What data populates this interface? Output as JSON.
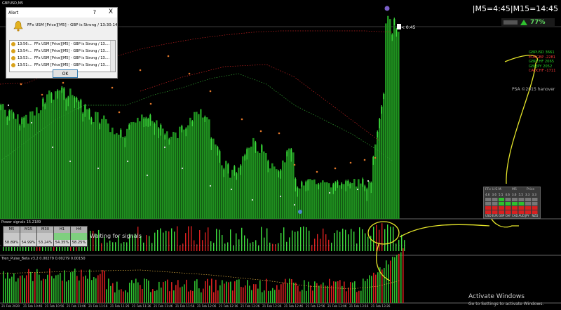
{
  "window": {
    "symbol_label": "GBPUSD,M5",
    "bid_label": "< 0:45"
  },
  "timer": {
    "text": "|M5=4:45|M15=14:45"
  },
  "percent": {
    "value": "77%"
  },
  "alert": {
    "title": "Alert",
    "help": "?",
    "close": "X",
    "message": "FFx USM [Price][M5] - GBP is Strong / 13:30:14",
    "rows": [
      {
        "time": "13:56:...",
        "text": "FFx USM [Price][M5] - GBP is Strong / 13...."
      },
      {
        "time": "13:54:...",
        "text": "FFx USM [Price][M5] - GBP is Strong / 13...."
      },
      {
        "time": "13:53:...",
        "text": "FFx USM [Price][M5] - GBP is Strong / 13...."
      },
      {
        "time": "13:51:...",
        "text": "FFx USM [Price][M5] - GBP is Strong / 13...."
      }
    ],
    "ok": "OK"
  },
  "pairs": [
    {
      "name": "GBPUSD",
      "value": "3661",
      "color": "#28d028"
    },
    {
      "name": "EURGBP",
      "value": "-2281",
      "color": "#ff3b3b"
    },
    {
      "name": "GBPCHF",
      "value": "2065",
      "color": "#28d028"
    },
    {
      "name": "GBPJPY",
      "value": "2052",
      "color": "#28d028"
    },
    {
      "name": "CADCHF",
      "value": "-1711",
      "color": "#ff3b3b"
    }
  ],
  "copyright": "PSA ©2015 hanover",
  "strength_panel": {
    "header": [
      "FFx U.S.M.",
      "M5",
      "Price"
    ],
    "values": [
      "4.6",
      "3.6",
      "5.5",
      "4.6",
      "3.6",
      "5.5",
      "3.3",
      "3.3"
    ],
    "currencies": [
      "USD",
      "EUR",
      "GBP",
      "CHF",
      "CAD",
      "AUD",
      "JPY",
      "NZD"
    ]
  },
  "indicator1": {
    "title": "Power signals 15.2189",
    "waiting": "Waiting for signals",
    "boxes": [
      {
        "tf": "M5",
        "value": "58.89%"
      },
      {
        "tf": "M15",
        "value": "54.99%"
      },
      {
        "tf": "M30",
        "value": "53.24%"
      },
      {
        "tf": "H1",
        "value": "54.35%"
      },
      {
        "tf": "H4",
        "value": "58.25%"
      }
    ]
  },
  "indicator2": {
    "title": "Tren_Pulse_Beta v3.2 0.00279 0.00279 0.00150"
  },
  "time_axis": [
    "21 Feb 2020",
    "21 Feb 10:46",
    "21 Feb 10:56",
    "21 Feb 11:06",
    "21 Feb 11:16",
    "21 Feb 11:26",
    "21 Feb 11:36",
    "21 Feb 11:46",
    "21 Feb 11:56",
    "21 Feb 12:06",
    "21 Feb 12:16",
    "21 Feb 12:26",
    "21 Feb 12:36",
    "21 Feb 12:46",
    "21 Feb 12:56",
    "21 Feb 13:06",
    "21 Feb 13:16",
    "21 Feb 13:26"
  ],
  "watermark": {
    "title": "Activate Windows",
    "subtitle": "Go to Settings to activate Windows."
  },
  "colors": {
    "bars": "#1f8f1f",
    "bars_bright": "#3fe03f",
    "red": "#d82020",
    "dots_orange": "#e0762a",
    "dots_red": "#c02020",
    "annotation": "#e6e62a"
  }
}
